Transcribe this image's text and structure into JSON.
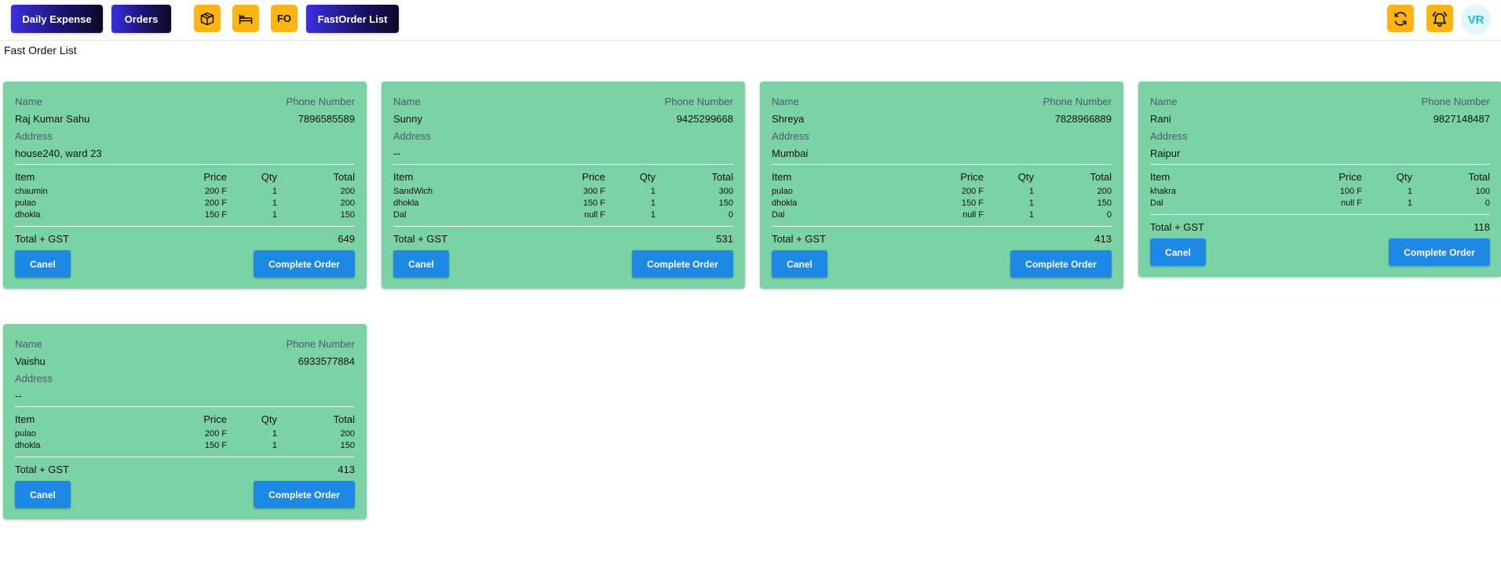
{
  "nav": {
    "daily_expense": "Daily Expense",
    "orders": "Orders",
    "fo": "FO",
    "fast_order_list": "FastOrder List",
    "avatar_initials": "VR"
  },
  "page": {
    "title": "Fast Order List"
  },
  "labels": {
    "name": "Name",
    "phone": "Phone Number",
    "address": "Address",
    "item": "Item",
    "price": "Price",
    "qty": "Qty",
    "total": "Total",
    "total_gst": "Total + GST",
    "cancel": "Canel",
    "complete": "Complete Order"
  },
  "orders": [
    {
      "name": "Raj Kumar Sahu",
      "phone": "7896585589",
      "address": "house240, ward 23",
      "items": [
        {
          "item": "chaumin",
          "price": "200 F",
          "qty": "1",
          "total": "200"
        },
        {
          "item": "pulao",
          "price": "200 F",
          "qty": "1",
          "total": "200"
        },
        {
          "item": "dhokla",
          "price": "150 F",
          "qty": "1",
          "total": "150"
        }
      ],
      "grand_total": "649"
    },
    {
      "name": "Sunny",
      "phone": "9425299668",
      "address": "--",
      "items": [
        {
          "item": "SandWich",
          "price": "300 F",
          "qty": "1",
          "total": "300"
        },
        {
          "item": "dhokla",
          "price": "150 F",
          "qty": "1",
          "total": "150"
        },
        {
          "item": "Dal",
          "price": "null F",
          "qty": "1",
          "total": "0"
        }
      ],
      "grand_total": "531"
    },
    {
      "name": "Shreya",
      "phone": "7828966889",
      "address": "Mumbai",
      "items": [
        {
          "item": "pulao",
          "price": "200 F",
          "qty": "1",
          "total": "200"
        },
        {
          "item": "dhokla",
          "price": "150 F",
          "qty": "1",
          "total": "150"
        },
        {
          "item": "Dal",
          "price": "null F",
          "qty": "1",
          "total": "0"
        }
      ],
      "grand_total": "413"
    },
    {
      "name": "Rani",
      "phone": "9827148487",
      "address": "Raipur",
      "items": [
        {
          "item": "khakra",
          "price": "100 F",
          "qty": "1",
          "total": "100"
        },
        {
          "item": "Dal",
          "price": "null F",
          "qty": "1",
          "total": "0"
        }
      ],
      "grand_total": "118"
    },
    {
      "name": "Vaishu",
      "phone": "6933577884",
      "address": "--",
      "items": [
        {
          "item": "pulao",
          "price": "200 F",
          "qty": "1",
          "total": "200"
        },
        {
          "item": "dhokla",
          "price": "150 F",
          "qty": "1",
          "total": "150"
        }
      ],
      "grand_total": "413"
    }
  ],
  "icons": {
    "box": "package-icon",
    "bed": "bed-icon",
    "refresh": "refresh-icon",
    "bell": "bell-icon"
  },
  "colors": {
    "card": "#7ad2a5",
    "accent_button": "#1e88e5",
    "icon_button": "#fbb411",
    "nav_gradient_start": "#3b2fe0",
    "nav_gradient_end": "#0c0a26"
  }
}
